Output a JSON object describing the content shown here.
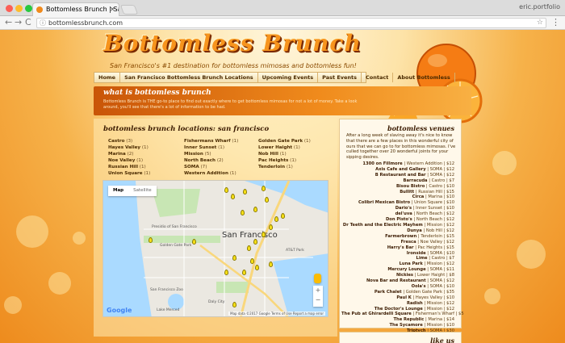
{
  "browser": {
    "tab_title": "Bottomless Brunch | San Franc",
    "tab_close": "×",
    "profile": "eric.portfolio",
    "url": "bottomlessbrunch.com",
    "back": "←",
    "forward": "→",
    "reload": "C",
    "menu": "⋮",
    "star": "☆",
    "info": "ⓘ"
  },
  "header": {
    "logo": "Bottomless Brunch",
    "tagline": "San Francisco's #1 destination for bottomless mimosas and bottomless fun!"
  },
  "nav": [
    "Home",
    "San Francisco Bottomless Brunch Locations",
    "Upcoming Events",
    "Past Events",
    "Contact",
    "About Bottomless"
  ],
  "banner": {
    "title": "what is bottomless brunch",
    "text": "Bottomless Brunch is THE go-to place to find out exactly where to get bottomless mimosas for not a lot of money. Take a look around, you'll see that there's a lot of information to be had."
  },
  "locations": {
    "title": "bottomless brunch locations: san francisco",
    "columns": [
      [
        {
          "name": "Castro",
          "count": "(3)"
        },
        {
          "name": "Hayes Valley",
          "count": "(1)"
        },
        {
          "name": "Marina",
          "count": "(2)"
        },
        {
          "name": "Noe Valley",
          "count": "(1)"
        },
        {
          "name": "Russian Hill",
          "count": "(1)"
        },
        {
          "name": "Union Square",
          "count": "(1)"
        }
      ],
      [
        {
          "name": "Fishermans Wharf",
          "count": "(1)"
        },
        {
          "name": "Inner Sunset",
          "count": "(1)"
        },
        {
          "name": "Mission",
          "count": "(5)"
        },
        {
          "name": "North Beach",
          "count": "(2)"
        },
        {
          "name": "SOMA",
          "count": "(7)"
        },
        {
          "name": "Western Addition",
          "count": "(1)"
        }
      ],
      [
        {
          "name": "Golden Gate Park",
          "count": "(1)"
        },
        {
          "name": "Lower Haight",
          "count": "(1)"
        },
        {
          "name": "Nob Hill",
          "count": "(1)"
        },
        {
          "name": "Pac Heights",
          "count": "(1)"
        },
        {
          "name": "Tenderloin",
          "count": "(1)"
        }
      ]
    ]
  },
  "map": {
    "tab_map": "Map",
    "tab_satellite": "Satellite",
    "city": "San Francisco",
    "labels": {
      "park": "Golden Gate Park",
      "presidio": "Presidio of San Francisco",
      "zoo": "San Francisco Zoo",
      "att": "AT&T Park",
      "lake": "Lake Merced",
      "dalycity": "Daly City"
    },
    "google": "Google",
    "attribution": "Map data ©2017 Google    Terms of Use    Report a map error",
    "zoom_in": "+",
    "zoom_out": "−"
  },
  "sidebar": {
    "title": "bottomless venues",
    "intro": "After a long week of slaving away it's nice to know that there are a few places in this wonderful city of ours that we can go to for bottomless mimosas. I've culled together over 20 wonderful joints for your sipping desires.",
    "venues": [
      {
        "name": "1300 on Fillmore",
        "info": "| Western Addition | $12"
      },
      {
        "name": "Axis Cafe and Gallery",
        "info": "| SOMA | $12"
      },
      {
        "name": "B Restaurant and Bar",
        "info": "| SOMA | $12"
      },
      {
        "name": "Barracuda",
        "info": "| Castro | $7"
      },
      {
        "name": "Bisou Bistro",
        "info": "| Castro | $10"
      },
      {
        "name": "Bullitt",
        "info": "| Russian Hill | $15"
      },
      {
        "name": "Circa",
        "info": "| Marina | $10"
      },
      {
        "name": "Colibri Mexican Bistro",
        "info": "| Union Square | $10"
      },
      {
        "name": "Dario's",
        "info": "| Inner Sunset | $10"
      },
      {
        "name": "del'uva",
        "info": "| North Beach | $12"
      },
      {
        "name": "Don Pisto's",
        "info": "| North Beach | $12"
      },
      {
        "name": "Dr Teeth and the Electric Mayhem",
        "info": "| Mission | $12"
      },
      {
        "name": "Dunya",
        "info": "| Nob Hill | $12"
      },
      {
        "name": "Farmerbrown",
        "info": "| Tenderloin | $15"
      },
      {
        "name": "Fresca",
        "info": "| Noe Valley | $12"
      },
      {
        "name": "Harry's Bar",
        "info": "| Pac Heights | $15"
      },
      {
        "name": "Ironside",
        "info": "| SOMA | $10"
      },
      {
        "name": "Lime",
        "info": "| Castro | $7"
      },
      {
        "name": "Luna Park",
        "info": "| Mission | $12"
      },
      {
        "name": "Mercury Lounge",
        "info": "| SOMA | $11"
      },
      {
        "name": "Nickies",
        "info": "| Lower Haight | $8"
      },
      {
        "name": "Nova Bar and Restaurant",
        "info": "| SOMA | $12"
      },
      {
        "name": "Oola's",
        "info": "| SOMA | $10"
      },
      {
        "name": "Park Chalet",
        "info": "| Golden Gate Park | $35"
      },
      {
        "name": "Paul K",
        "info": "| Hayes Valley | $10"
      },
      {
        "name": "Radish",
        "info": "| Mission | $12"
      },
      {
        "name": "The Doctor's Lounge",
        "info": "| Mission | $12"
      },
      {
        "name": "The Pub at Ghirardelli Square",
        "info": "| Fisherman's Wharf | $5"
      },
      {
        "name": "The Republic",
        "info": "| Marina | $14"
      },
      {
        "name": "The Sycamore",
        "info": "| Mission | $10"
      },
      {
        "name": "Triptych",
        "info": "| SOMA | $30"
      }
    ],
    "next_title": "like us"
  }
}
